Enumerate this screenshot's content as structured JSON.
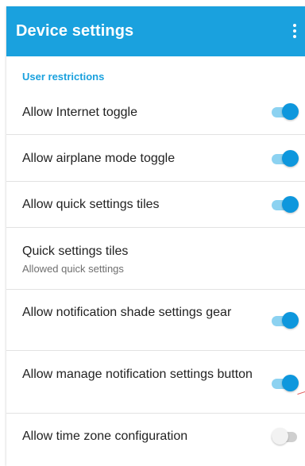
{
  "app_bar": {
    "title": "Device settings",
    "menu_icon": "more-vert-icon",
    "background_color": "#1aa1de"
  },
  "section": {
    "header": "User restrictions",
    "accent_color": "#1aa1de"
  },
  "items": [
    {
      "label": "Allow Internet toggle",
      "type": "switch",
      "checked": true
    },
    {
      "label": "Allow airplane mode toggle",
      "type": "switch",
      "checked": true
    },
    {
      "label": "Allow quick settings tiles",
      "type": "switch",
      "checked": true
    },
    {
      "label": "Quick settings tiles",
      "summary": "Allowed quick settings",
      "type": "preference"
    },
    {
      "label": "Allow notification shade settings gear",
      "type": "switch",
      "checked": true
    },
    {
      "label": "Allow manage notification settings button",
      "type": "switch",
      "checked": true
    },
    {
      "label": "Allow time zone configuration",
      "type": "switch",
      "checked": false
    }
  ]
}
